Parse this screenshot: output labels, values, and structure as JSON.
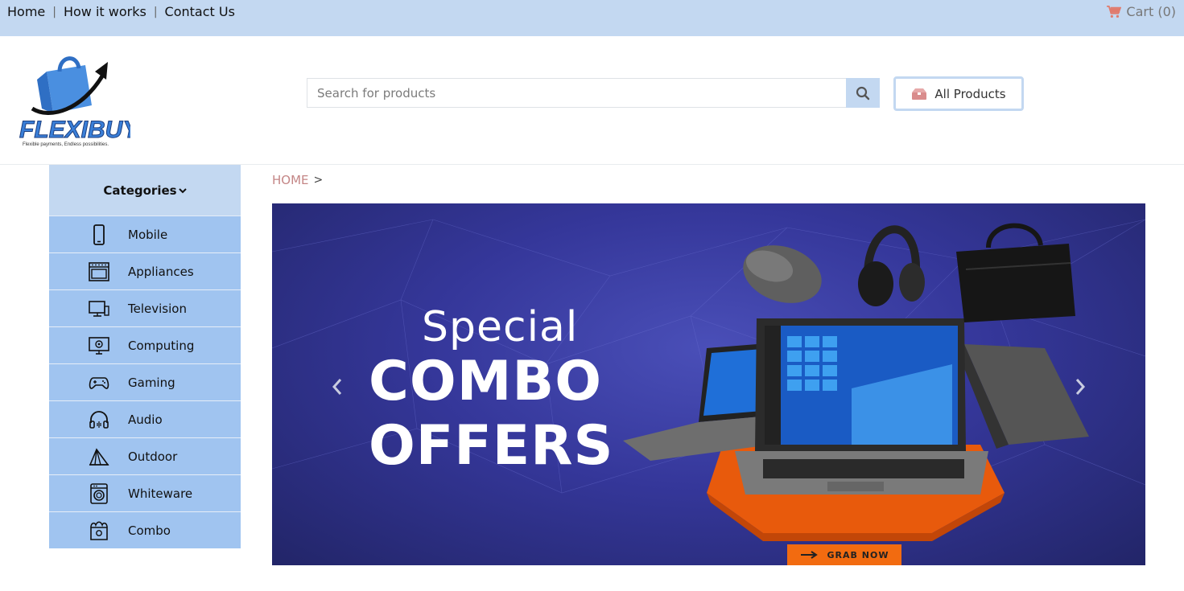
{
  "topnav": {
    "home": "Home",
    "how": "How it works",
    "contact": "Contact Us",
    "sep": "|"
  },
  "cart": {
    "label": "Cart (0)"
  },
  "logo": {
    "text": "FLEXIBUY",
    "tagline": "Flexible payments, Endless possibilities."
  },
  "search": {
    "placeholder": "Search for products"
  },
  "all_products": {
    "label": "All Products"
  },
  "sidebar": {
    "heading": "Categories",
    "items": [
      {
        "label": "Mobile",
        "icon": "mobile-icon"
      },
      {
        "label": "Appliances",
        "icon": "oven-icon"
      },
      {
        "label": "Television",
        "icon": "television-icon"
      },
      {
        "label": "Computing",
        "icon": "computer-icon"
      },
      {
        "label": "Gaming",
        "icon": "gamepad-icon"
      },
      {
        "label": "Audio",
        "icon": "headphones-icon"
      },
      {
        "label": "Outdoor",
        "icon": "tent-icon"
      },
      {
        "label": "Whiteware",
        "icon": "washing-machine-icon"
      },
      {
        "label": "Combo",
        "icon": "combo-icon"
      }
    ]
  },
  "breadcrumb": {
    "home": "HOME",
    "chevron": ">"
  },
  "banner": {
    "line1": "Special",
    "line2": "COMBO",
    "line3": "OFFERS",
    "cta": "GRAB NOW"
  },
  "colors": {
    "topbar": "#c3d8f1",
    "sidebar_item": "#a0c4f0",
    "cta": "#f26b10",
    "breadcrumb": "#c48686"
  }
}
